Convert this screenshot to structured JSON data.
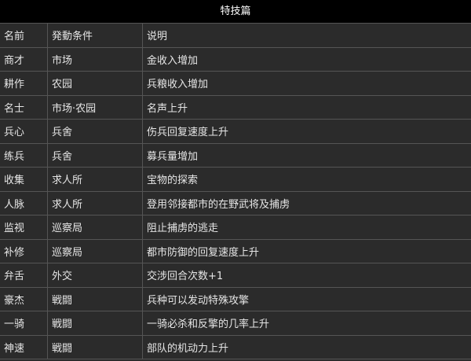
{
  "title": "特技篇",
  "columns": [
    "名前",
    "発動条件",
    "说明"
  ],
  "rows": [
    [
      "商才",
      "市场",
      "金收入增加"
    ],
    [
      "耕作",
      "农园",
      "兵粮收入增加"
    ],
    [
      "名士",
      "市场·农园",
      "名声上升"
    ],
    [
      "兵心",
      "兵舍",
      "伤兵回复速度上升"
    ],
    [
      "练兵",
      "兵舍",
      "募兵量增加"
    ],
    [
      "收集",
      "求人所",
      "宝物的探索"
    ],
    [
      "人脉",
      "求人所",
      "登用邻接都市的在野武将及捕虏"
    ],
    [
      "监视",
      "巡察局",
      "阻止捕虏的逃走"
    ],
    [
      "补修",
      "巡察局",
      "都市防御的回复速度上升"
    ],
    [
      "弁舌",
      "外交",
      "交涉回合次数+1"
    ],
    [
      "豪杰",
      "戦闘",
      "兵种可以发动特殊攻擎"
    ],
    [
      "一骑",
      "戦闘",
      "一骑必杀和反擎的几率上升"
    ],
    [
      "神速",
      "戦闘",
      "部队的机动力上升"
    ]
  ]
}
